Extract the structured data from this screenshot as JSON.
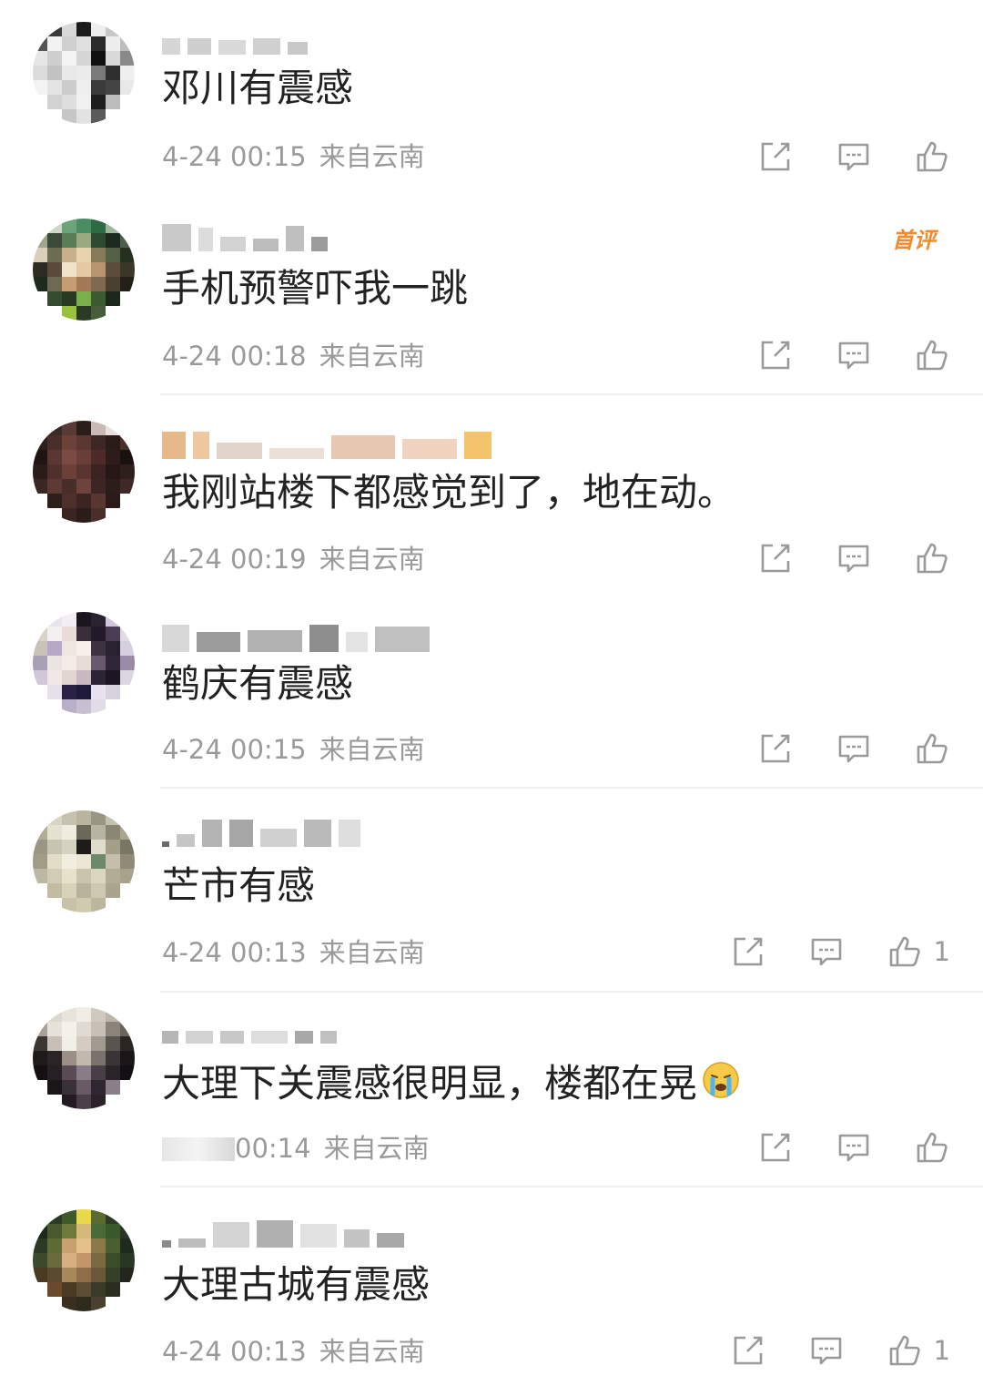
{
  "comments": [
    {
      "text": "邓川有震感",
      "time": "4-24 00:15",
      "location": "来自云南",
      "likes": ""
    },
    {
      "text": "手机预警吓我一跳",
      "time": "4-24 00:18",
      "location": "来自云南",
      "likes": "",
      "badge": "首评"
    },
    {
      "text": "我刚站楼下都感觉到了，地在动。",
      "time": "4-24 00:19",
      "location": "来自云南",
      "likes": ""
    },
    {
      "text": "鹤庆有震感",
      "time": "4-24 00:15",
      "location": "来自云南",
      "likes": ""
    },
    {
      "text": "芒市有感",
      "time": "4-24 00:13",
      "location": "来自云南",
      "likes": "1"
    },
    {
      "text": "大理下关震感很明显，楼都在晃",
      "time": "00:14",
      "location": "来自云南",
      "likes": "",
      "emoji": "crying-face"
    },
    {
      "text": "大理古城有震感",
      "time": "4-24 00:13",
      "location": "来自云南",
      "likes": "1"
    }
  ],
  "colors": {
    "text": "#222222",
    "meta": "#9a9a9a",
    "badge": "#f08a2a",
    "divider": "#efefef",
    "icon": "#9a9a9a"
  },
  "icons": [
    "repost-icon",
    "comment-icon",
    "like-icon"
  ]
}
